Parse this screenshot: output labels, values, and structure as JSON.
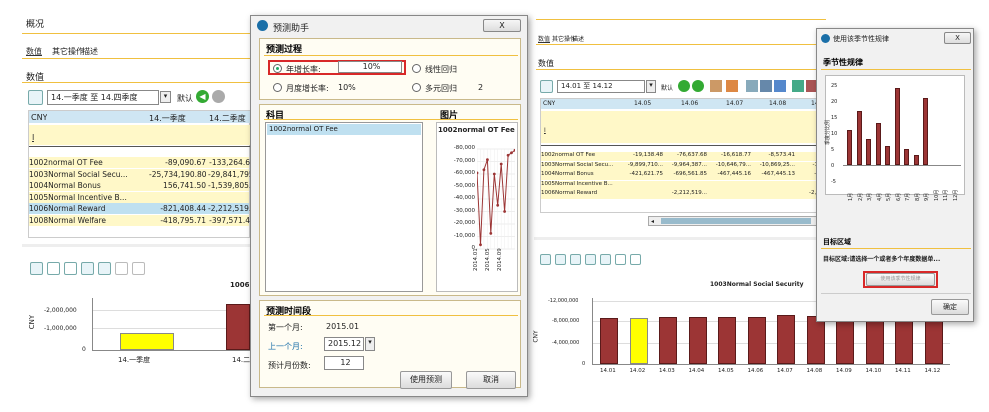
{
  "left": {
    "title": "概况",
    "tabs": [
      "数值",
      "其它操作",
      "描述"
    ],
    "section": "数值",
    "range": "14.一季度 至 14.四季度",
    "default_label": "默认",
    "col_head": [
      "CNY",
      "14.一季度",
      "14.二季度"
    ],
    "row_i": "I",
    "rows": [
      {
        "name": "1002normal OT Fee",
        "v1": "-89,090.67",
        "v2": "-133,264.6"
      },
      {
        "name": "1003Normal Social Secu...",
        "v1": "-25,734,190.80",
        "v2": "-29,841,795.6"
      },
      {
        "name": "1004Normal Bonus",
        "v1": "156,741.50",
        "v2": "-1,539,805.3"
      },
      {
        "name": "1005Normal Incentive B...",
        "v1": "",
        "v2": ""
      },
      {
        "name": "1006Normal Reward",
        "v1": "-821,408.44",
        "v2": "-2,212,519.4"
      },
      {
        "name": "1008Normal Welfare",
        "v1": "-418,795.71",
        "v2": "-397,571.4"
      }
    ],
    "chart": {
      "title_frag": "1006",
      "ylabel": "CNY",
      "yticks": [
        "-2,000,000",
        "-1,000,000",
        "0"
      ],
      "xticks": [
        "14.一季度",
        "14.二"
      ]
    }
  },
  "chart_data": [
    {
      "type": "bar",
      "categories": [
        "14.一季度",
        "14.二季度"
      ],
      "values": [
        -821408.44,
        -2212519.4
      ],
      "ylabel": "CNY",
      "ylim": [
        -2500000,
        0
      ]
    },
    {
      "type": "line",
      "title": "1002normal OT Fee",
      "x": [
        "2014.01",
        "2014.02",
        "2014.03",
        "2014.04",
        "2014.05",
        "2014.06",
        "2014.07",
        "2014.08",
        "2014.09",
        "2014.10",
        "2014.11",
        "2014.12"
      ],
      "values": [
        -19138,
        -76637,
        -16619,
        -8573,
        -67506,
        -20000,
        -45000,
        -12000,
        -50000,
        -5000,
        -3000,
        -1000
      ],
      "yticks": [
        "-80,000",
        "-70,000",
        "-60,000",
        "-50,000",
        "-40,000",
        "-30,000",
        "-20,000",
        "-10,000",
        "0"
      ],
      "ylim": [
        -80000,
        0
      ]
    },
    {
      "type": "bar",
      "title": "1003Normal Social Security",
      "categories": [
        "14.01",
        "14.02",
        "14.03",
        "14.04",
        "14.05",
        "14.06",
        "14.07",
        "14.08",
        "14.09",
        "14.10",
        "14.11",
        "14.12"
      ],
      "values": [
        -8400000,
        -8400000,
        -8600000,
        -8600000,
        -8600000,
        -8600000,
        -9000000,
        -8800000,
        -9000000,
        -8000000,
        -8000000,
        -8000000
      ],
      "ylabel": "CNY",
      "ylim": [
        -12000000,
        0
      ]
    },
    {
      "type": "bar",
      "ylabel": "季度分比例",
      "categories": [
        "1月",
        "2月",
        "3月",
        "4月",
        "5月",
        "6月",
        "7月",
        "8月",
        "9月",
        "10月",
        "11月",
        "12月"
      ],
      "values": [
        11,
        17,
        8,
        13,
        6,
        24,
        5,
        3,
        21,
        0,
        0,
        0
      ],
      "ylim": [
        -5,
        25
      ]
    }
  ],
  "dlg1": {
    "title": "预测助手",
    "close": "X",
    "process_title": "预测过程",
    "r1": "年增长率:",
    "r1val": "10%",
    "r2": "线性回归",
    "r3": "月度增长率:",
    "r3val": "10%",
    "r4": "多元回归",
    "r4val": "2",
    "subject_title": "科目",
    "subject_item": "1002normal OT Fee",
    "picture_title": "图片",
    "period_title": "预测时间段",
    "first_month_label": "第一个月:",
    "first_month": "2015.01",
    "last_month_label": "上一个月:",
    "last_month": "2015.12",
    "months_label": "预计月份数:",
    "months": "12",
    "use_btn": "使用预测",
    "cancel_btn": "取消"
  },
  "right": {
    "tabs": [
      "数值",
      "其它操作",
      "描述"
    ],
    "section": "数值",
    "range": "14.01 至 14.12",
    "default_label": "默认",
    "col_head": [
      "CNY",
      "14.05",
      "14.06",
      "14.07",
      "14.08",
      "14.09"
    ],
    "row_i": "I",
    "rows": [
      {
        "name": "1002normal OT Fee",
        "c": [
          "-19,138.48",
          "-76,637.68",
          "-16,618.77",
          "-8,573.41",
          "-67,506"
        ]
      },
      {
        "name": "1003Normal Social Secu...",
        "c": [
          "-9,899,710...",
          "-9,964,387...",
          "-10,646,79...",
          "-10,869,25...",
          "-10,772,0"
        ]
      },
      {
        "name": "1004Normal Bonus",
        "c": [
          "-421,621.75",
          "-696,561.85",
          "-467,445.16",
          "-467,445.13",
          "-528,781"
        ]
      },
      {
        "name": "1005Normal Incentive B...",
        "c": [
          "",
          "",
          "",
          "",
          ""
        ]
      },
      {
        "name": "1006Normal Reward",
        "c": [
          "",
          "-2,212,519...",
          "",
          "",
          "-2,036,739"
        ]
      }
    ],
    "chart": {
      "title": "1003Normal Social Security",
      "ylabel": "CNY",
      "yticks": [
        "-12,000,000",
        "-8,000,000",
        "-4,000,000",
        "0"
      ]
    }
  },
  "dlg2": {
    "title": "使用该季节性规律",
    "close": "X",
    "season_title": "季节性规律",
    "yticks": [
      "25",
      "20",
      "15",
      "10",
      "5",
      "0",
      "-5"
    ],
    "ylabel": "季度分比例",
    "target_title": "目标区域",
    "target_text": "目标区域:请选择一个或者多个年度数据单...",
    "apply_btn": "使用该季节性规律",
    "ok_btn": "确定"
  }
}
